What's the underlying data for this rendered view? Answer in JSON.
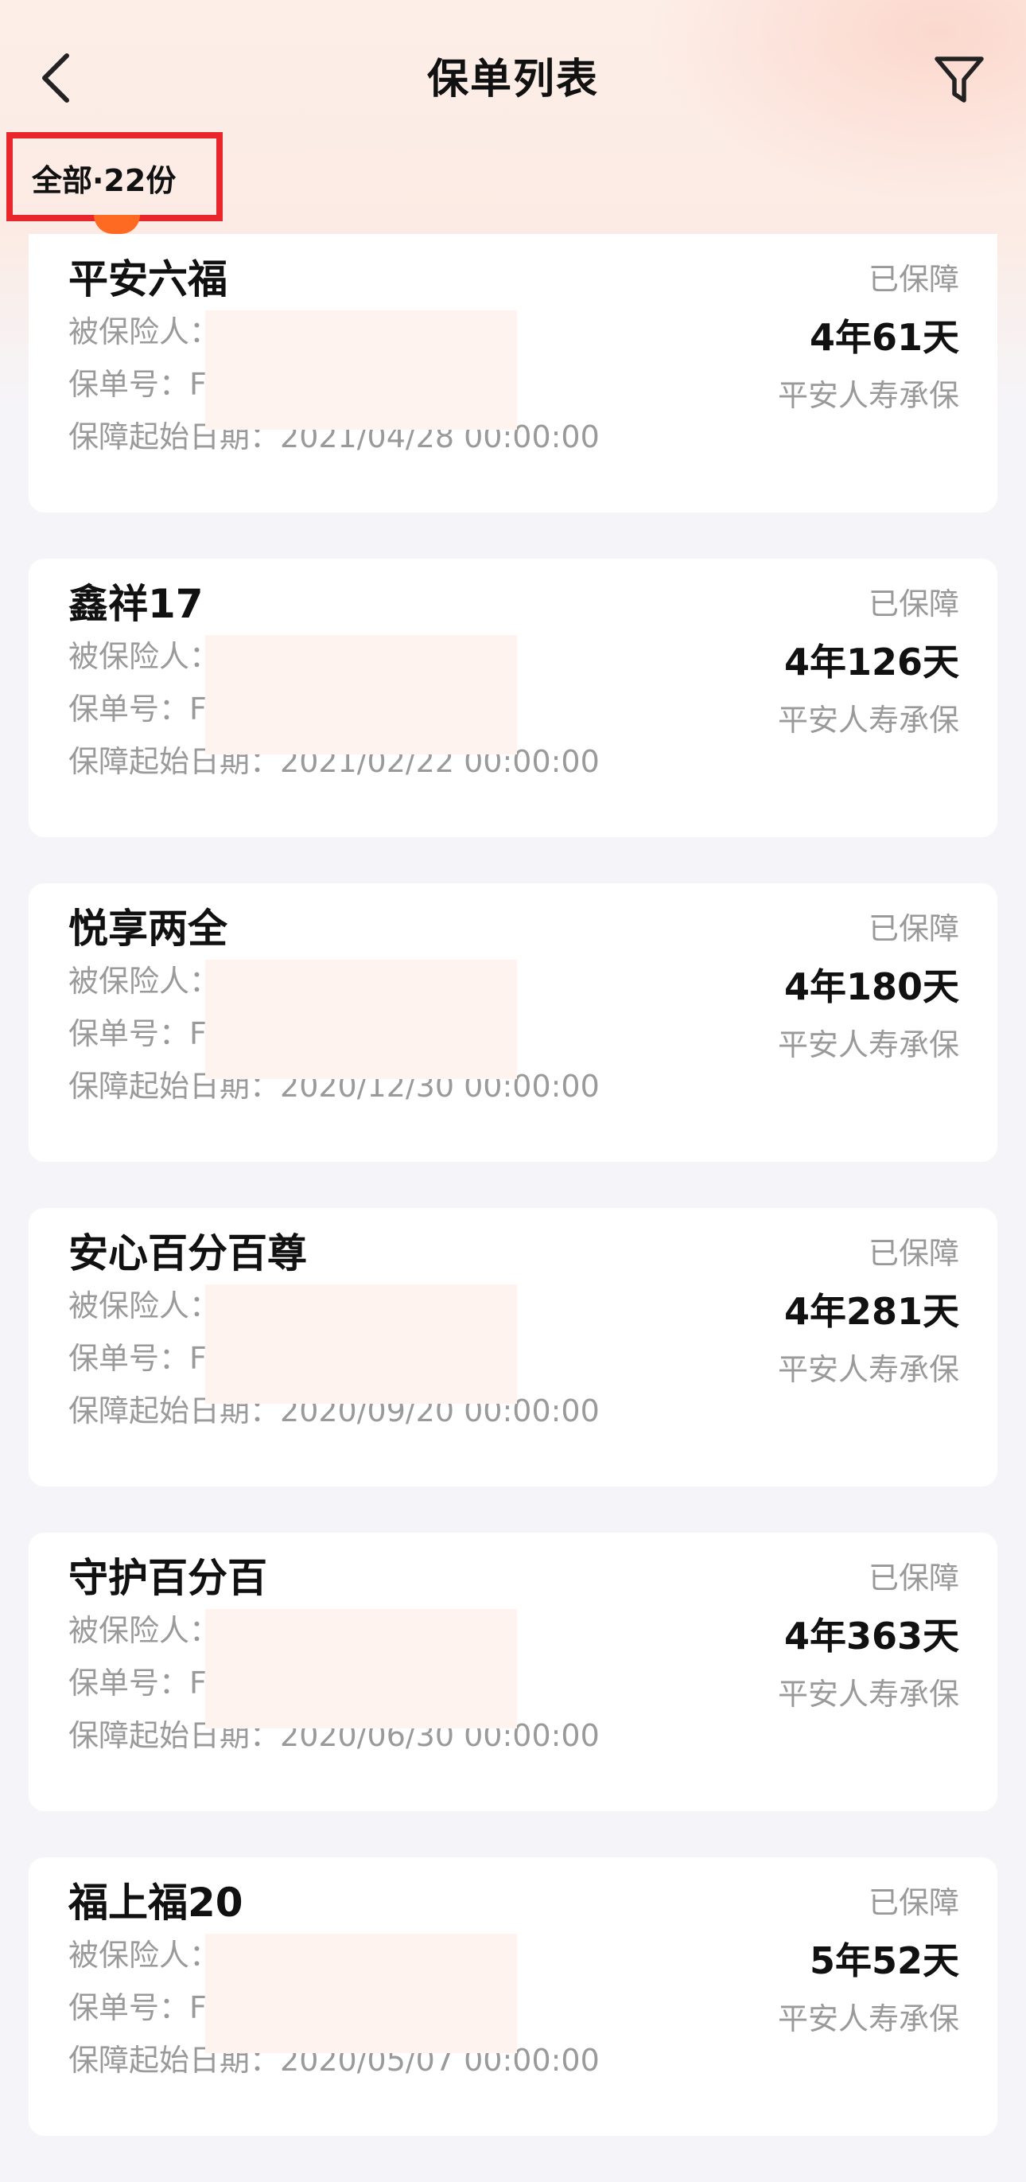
{
  "header": {
    "title": "保单列表",
    "back_icon": "chevron-left-icon",
    "filter_icon": "funnel-icon"
  },
  "filter_chip": {
    "label": "全部·22份",
    "highlight_color": "#e8262b",
    "dot_color": "#ff6a22"
  },
  "labels": {
    "insured": "被保险人：",
    "policy_no": "保单号：F",
    "start_date": "保障起始日期："
  },
  "policies": [
    {
      "name": "平安六福",
      "status": "已保障",
      "duration": "4年61天",
      "underwriter": "平安人寿承保",
      "start_date": "2021/04/28 00:00:00"
    },
    {
      "name": "鑫祥17",
      "status": "已保障",
      "duration": "4年126天",
      "underwriter": "平安人寿承保",
      "start_date": "2021/02/22 00:00:00"
    },
    {
      "name": "悦享两全",
      "status": "已保障",
      "duration": "4年180天",
      "underwriter": "平安人寿承保",
      "start_date": "2020/12/30 00:00:00"
    },
    {
      "name": "安心百分百尊",
      "status": "已保障",
      "duration": "4年281天",
      "underwriter": "平安人寿承保",
      "start_date": "2020/09/20 00:00:00"
    },
    {
      "name": "守护百分百",
      "status": "已保障",
      "duration": "4年363天",
      "underwriter": "平安人寿承保",
      "start_date": "2020/06/30 00:00:00"
    },
    {
      "name": "福上福20",
      "status": "已保障",
      "duration": "5年52天",
      "underwriter": "平安人寿承保",
      "start_date": "2020/05/07 00:00:00"
    }
  ]
}
